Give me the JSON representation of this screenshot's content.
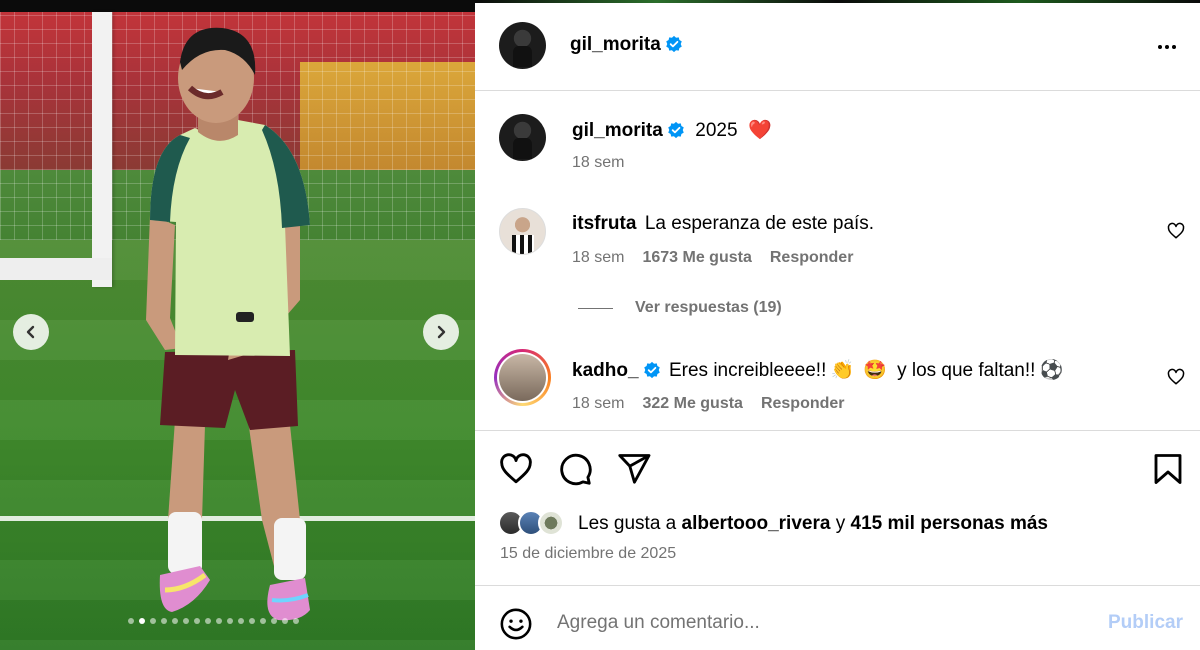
{
  "post": {
    "author": "gil_morita",
    "caption_text": "2025",
    "caption_emoji": "❤️",
    "caption_time": "18 sem"
  },
  "photo": {
    "carousel_total": 16,
    "carousel_active_index": 1,
    "prev_icon": "chevron-left-icon",
    "next_icon": "chevron-right-icon"
  },
  "comments": [
    {
      "user": "itsfruta",
      "verified": false,
      "text": "La esperanza de este país.",
      "time": "18 sem",
      "likes": "1673 Me gusta",
      "reply_label": "Responder"
    },
    {
      "user": "kadho_",
      "verified": true,
      "text_start": "Eres increibleeee!!",
      "emoji_1": "👏",
      "emoji_2": "🤩",
      "text_mid": "y los que faltan!!",
      "emoji_3": "⚽",
      "time": "18 sem",
      "likes": "322 Me gusta",
      "reply_label": "Responder"
    }
  ],
  "view_replies": "Ver respuestas (19)",
  "likes": {
    "prefix": "Les gusta a",
    "user": "albertooo_rivera",
    "joiner": "y",
    "others": "415 mil personas más"
  },
  "date": "15 de diciembre de 2025",
  "composer": {
    "placeholder": "Agrega un comentario...",
    "post_label": "Publicar"
  },
  "colors": {
    "verified_blue": "#0095f6",
    "muted": "#737373",
    "post_disabled": "#b3cdf7",
    "heart_red": "#ff3040"
  }
}
